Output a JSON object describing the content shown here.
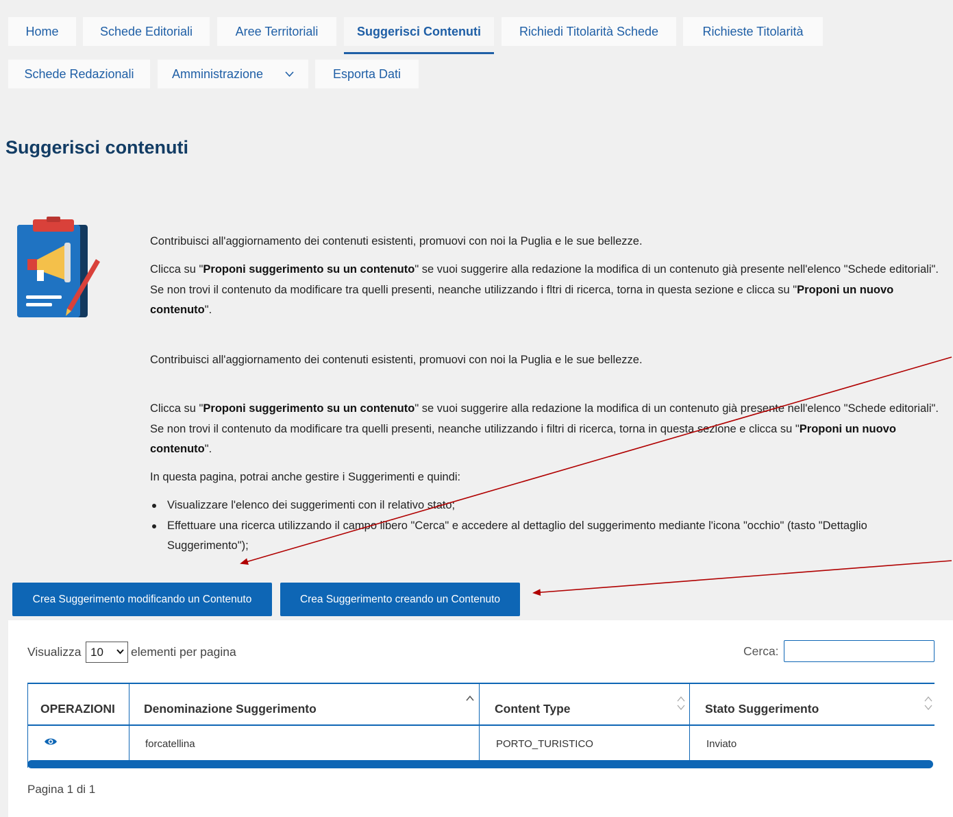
{
  "nav": {
    "tabs": [
      {
        "label": "Home"
      },
      {
        "label": "Schede Editoriali"
      },
      {
        "label": "Aree Territoriali"
      },
      {
        "label": "Suggerisci Contenuti"
      },
      {
        "label": "Richiedi Titolarità Schede"
      },
      {
        "label": "Richieste Titolarità"
      },
      {
        "label": "Schede Redazionali"
      },
      {
        "label": "Amministrazione"
      },
      {
        "label": "Esporta Dati"
      }
    ],
    "active_tab": "Suggerisci Contenuti"
  },
  "page_title": "Suggerisci contenuti",
  "intro": {
    "p1": "Contribuisci all'aggiornamento dei contenuti esistenti, promuovi con noi la Puglia e le sue bellezze.",
    "p2_pre": "Clicca su \"",
    "p2_bold1": "Proponi suggerimento su un contenuto",
    "p2_mid": "\" se vuoi suggerire alla redazione la modifica di un contenuto già presente nell'elenco \"Schede editoriali\". Se non trovi il contenuto da modificare tra quelli presenti, neanche utilizzando i fltri di ricerca, torna in questa sezione e clicca su \"",
    "p2_bold2": "Proponi un nuovo contenuto",
    "p2_post": "\".",
    "p3": "Contribuisci all'aggiornamento dei contenuti esistenti, promuovi con noi la Puglia e le sue bellezze.",
    "p4_pre": "Clicca su \"",
    "p4_bold1": "Proponi suggerimento su un contenuto",
    "p4_mid": "\" se vuoi suggerire alla redazione la modifica di un contenuto già presente nell'elenco \"Schede editoriali\". Se non trovi il contenuto da modificare tra quelli presenti, neanche utilizzando i filtri di ricerca, torna in questa sezione e clicca su \"",
    "p4_bold2": "Proponi un nuovo contenuto",
    "p4_post": "\".",
    "p5": "In questa pagina, potrai anche gestire i Suggerimenti e quindi:",
    "bullets": [
      "Visualizzare l'elenco dei suggerimenti con il relativo stato;",
      "Effettuare una ricerca utilizzando il campo libero \"Cerca\" e accedere al dettaglio del suggerimento mediante l'icona \"occhio\" (tasto \"Dettaglio Suggerimento\");"
    ]
  },
  "buttons": {
    "modify": "Crea Suggerimento modificando un Contenuto",
    "create": "Crea Suggerimento creando un Contenuto"
  },
  "table": {
    "length_prefix": "Visualizza",
    "length_value": "10",
    "length_suffix": "elementi per pagina",
    "search_label": "Cerca:",
    "headers": [
      "OPERAZIONI",
      "Denominazione Suggerimento",
      "Content Type",
      "Stato Suggerimento"
    ],
    "rows": [
      {
        "name": "forcatellina",
        "content_type": "PORTO_TURISTICO",
        "status": "Inviato"
      }
    ],
    "pager": "Pagina 1 di 1"
  },
  "colors": {
    "primary": "#0e66b5",
    "nav_text": "#1f5fa6",
    "title": "#123c64",
    "annotation_arrow": "#b00000"
  }
}
